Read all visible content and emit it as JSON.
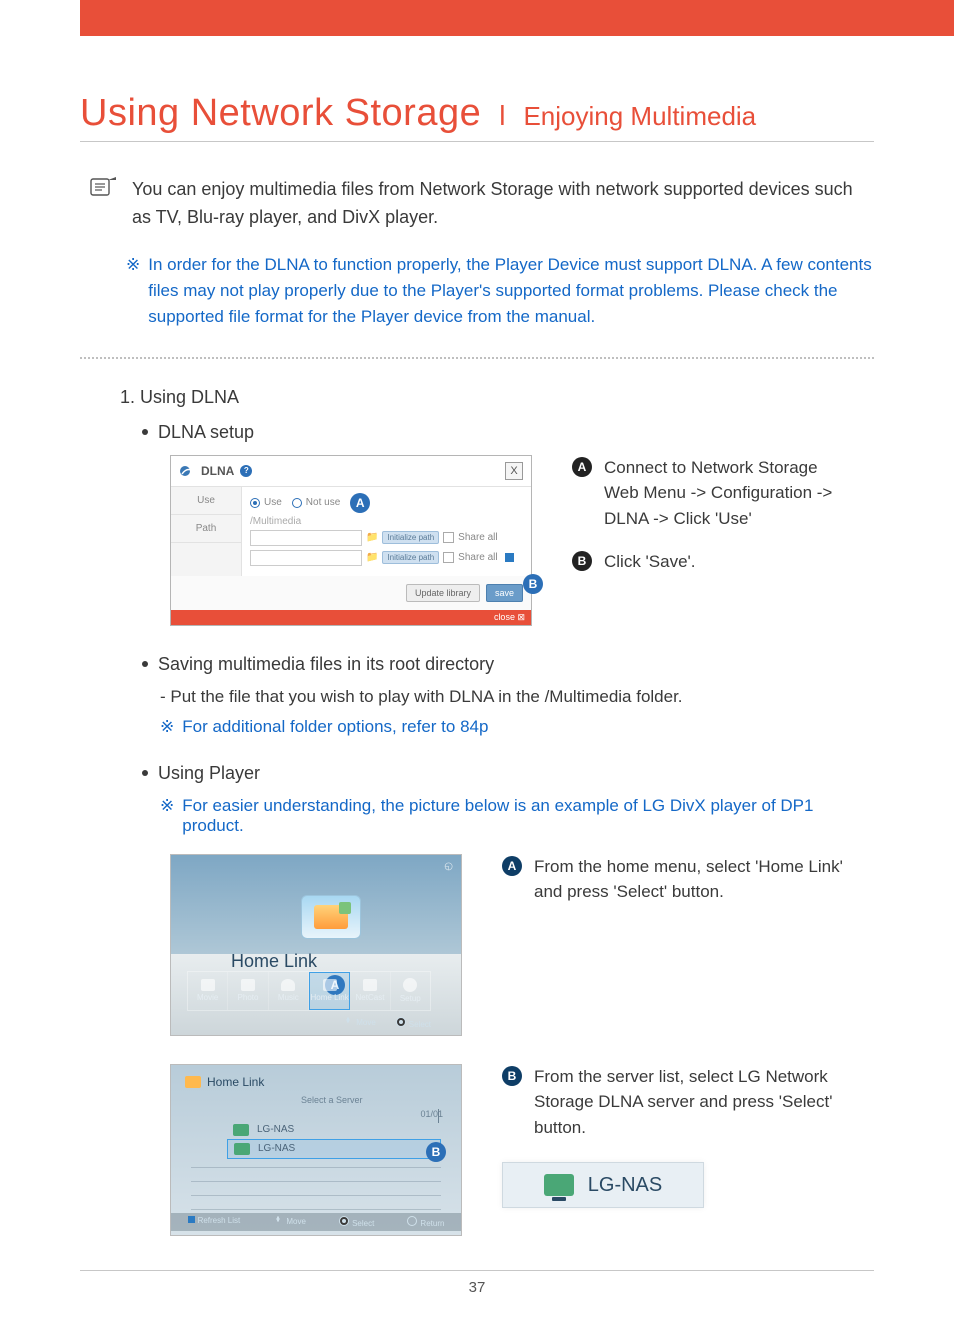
{
  "header": {
    "title_main": "Using Network Storage",
    "title_sub": "Enjoying Multimedia"
  },
  "intro": "You can enjoy multimedia files from Network Storage with network supported devices such as TV, Blu-ray player, and DivX player.",
  "caveat": "In order for the DLNA to function properly, the Player Device must support DLNA. A few contents files may not play properly due to the Player's supported format problems. Please check the supported file format for the Player device from the manual.",
  "step1": {
    "heading": "1. Using DLNA",
    "bullet_setup": "DLNA setup"
  },
  "dlna_window": {
    "title": "DLNA",
    "row_use": "Use",
    "row_path": "Path",
    "radio_use": "Use",
    "radio_notuse": "Not use",
    "mm_label": "/Multimedia",
    "init_btn": "Initialize path",
    "share_label": "Share all",
    "update_btn": "Update library",
    "save_btn": "save",
    "close": "close"
  },
  "callouts1": {
    "A": "Connect to Network Storage Web Menu -> Configuration -> DLNA -> Click 'Use'",
    "B": "Click 'Save'."
  },
  "save_root": {
    "bullet": "Saving multimedia files in its root directory",
    "line": "- Put the file that you wish to play with DLNA in the /Multimedia folder.",
    "note": "For additional folder options, refer to 84p"
  },
  "player": {
    "bullet": "Using Player",
    "note": "For easier understanding, the picture below is an example of LG DivX player of DP1 product."
  },
  "player1": {
    "title": "Home Link",
    "items": [
      "Movie",
      "Photo",
      "Music",
      "Home Link",
      "NetCast",
      "Setup"
    ],
    "foot_move": "Move",
    "foot_select": "Select",
    "callout": "From the home menu, select 'Home Link' and press 'Select' button."
  },
  "player2": {
    "title": "Home Link",
    "subtitle": "Select a Server",
    "count": "01/01",
    "server": "LG-NAS",
    "foot": [
      "Refresh List",
      "Move",
      "Select",
      "Return"
    ],
    "callout": "From the server list, select LG Network Storage DLNA server and press 'Select' button."
  },
  "nas_badge": "LG-NAS",
  "marks": {
    "A": "A",
    "B": "B"
  },
  "note_star": "※",
  "page_no": "37"
}
